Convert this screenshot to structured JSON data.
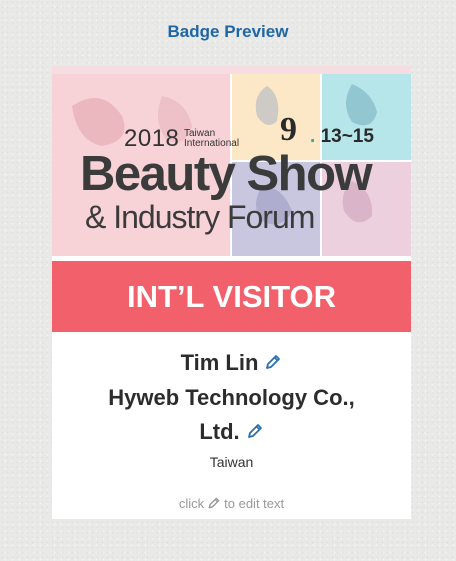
{
  "header": {
    "title": "Badge Preview"
  },
  "banner": {
    "year": "2018",
    "taiwan": "Taiwan",
    "international": "International",
    "date_month": "9",
    "date_dot": ".",
    "date_days": "13~15",
    "line1": "Beauty Show",
    "line2": "& Industry Forum"
  },
  "badge": {
    "role": "INT’L VISITOR",
    "name": "Tim Lin",
    "company_line1": "Hyweb Technology Co.,",
    "company_line2": "Ltd.",
    "country": "Taiwan"
  },
  "hint": {
    "before": "click",
    "after": "to edit text"
  },
  "icons": {
    "edit": "pencil-icon"
  },
  "colors": {
    "title": "#1f66a6",
    "role_band": "#f1606b",
    "accent_teal": "#27a7b8"
  }
}
